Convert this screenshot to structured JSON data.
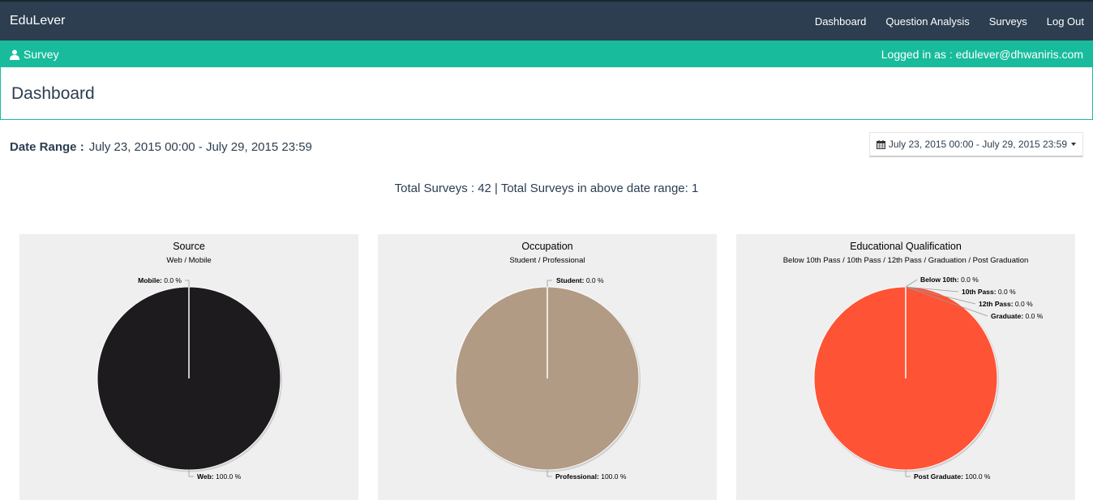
{
  "app": {
    "brand": "EduLever"
  },
  "nav": {
    "items": [
      "Dashboard",
      "Question Analysis",
      "Surveys",
      "Log Out"
    ]
  },
  "subbar": {
    "section": "Survey",
    "logged_in": "Logged in as : edulever@dhwaniris.com"
  },
  "page": {
    "title": "Dashboard"
  },
  "date_range": {
    "label": "Date Range :",
    "value": "July 23, 2015 00:00 - July 29, 2015 23:59",
    "picker_value": "July 23, 2015 00:00 - July 29, 2015 23:59"
  },
  "totals": "Total Surveys : 42 | Total Surveys in above date range: 1",
  "chart_data": [
    {
      "type": "pie",
      "title": "Source",
      "subtitle": "Web / Mobile",
      "slices": [
        {
          "name": "Mobile",
          "value": 0.0,
          "label": "Mobile: 0.0 %"
        },
        {
          "name": "Web",
          "value": 100.0,
          "label": "Web: 100.0 %"
        }
      ],
      "colors": [
        "#1e1b1f"
      ]
    },
    {
      "type": "pie",
      "title": "Occupation",
      "subtitle": "Student / Professional",
      "slices": [
        {
          "name": "Student",
          "value": 0.0,
          "label": "Student: 0.0 %"
        },
        {
          "name": "Professional",
          "value": 100.0,
          "label": "Professional: 100.0 %"
        }
      ],
      "colors": [
        "#b29b85"
      ]
    },
    {
      "type": "pie",
      "title": "Educational Qualification",
      "subtitle": "Below 10th Pass / 10th Pass / 12th Pass / Graduation / Post Graduation",
      "slices": [
        {
          "name": "Below 10th",
          "value": 0.0,
          "label": "Below 10th: 0.0 %"
        },
        {
          "name": "10th Pass",
          "value": 0.0,
          "label": "10th Pass: 0.0 %"
        },
        {
          "name": "12th Pass",
          "value": 0.0,
          "label": "12th Pass: 0.0 %"
        },
        {
          "name": "Graduate",
          "value": 0.0,
          "label": "Graduate: 0.0 %"
        },
        {
          "name": "Post Graduate",
          "value": 100.0,
          "label": "Post Graduate: 100.0 %"
        }
      ],
      "colors": [
        "#ff5335"
      ]
    }
  ]
}
